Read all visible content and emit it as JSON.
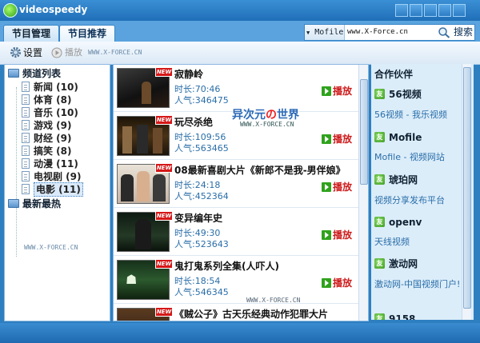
{
  "window": {
    "title": "videospeedy"
  },
  "tabs": [
    {
      "label": "节目管理",
      "active": false
    },
    {
      "label": "节目推荐",
      "active": true
    }
  ],
  "search": {
    "engine": "Mofile",
    "value": "www.X-Force.cn",
    "button": "搜索"
  },
  "toolbar": {
    "settings_label": "设置",
    "play_label": "播放",
    "watermark": "WWW.X-FORCE.CN"
  },
  "sidebar": {
    "root_label": "频道列表",
    "items": [
      {
        "label": "新闻 (10)"
      },
      {
        "label": "体育 (8)"
      },
      {
        "label": "音乐 (10)"
      },
      {
        "label": "游戏 (9)"
      },
      {
        "label": "财经 (9)"
      },
      {
        "label": "搞笑 (8)"
      },
      {
        "label": "动漫 (11)"
      },
      {
        "label": "电视剧 (9)"
      },
      {
        "label": "电影 (11)",
        "selected": true
      }
    ],
    "latest_label": "最新最热",
    "watermark": "WWW.X-FORCE.CN"
  },
  "videos": [
    {
      "title": "寂静岭",
      "duration": "时长:70:46",
      "popularity": "人气:346475",
      "badge": "NEW",
      "play": "播放"
    },
    {
      "title": "玩尽杀绝",
      "duration": "时长:109:56",
      "popularity": "人气:563465",
      "badge": "NEW",
      "play": "播放"
    },
    {
      "title": "08最新喜剧大片《新郎不是我-男伴娘》",
      "duration": "时长:24:18",
      "popularity": "人气:452364",
      "badge": "NEW",
      "play": "播放"
    },
    {
      "title": "变异编年史",
      "duration": "时长:49:30",
      "popularity": "人气:523643",
      "badge": "NEW",
      "play": "播放"
    },
    {
      "title": "鬼打鬼系列全集(人吓人)",
      "duration": "时长:18:54",
      "popularity": "人气:546345",
      "badge": "NEW",
      "play": "播放"
    },
    {
      "title": "《贼公子》古天乐经典动作犯罪大片",
      "duration": "",
      "popularity": "",
      "badge": "NEW",
      "play": ""
    }
  ],
  "watermark": {
    "logo_a": "异次元",
    "logo_b": "の",
    "logo_c": "世界",
    "sub": "WWW.X-FORCE.CN",
    "list_bottom": "WWW.X-FORCE.CN"
  },
  "partners": {
    "header": "合作伙伴",
    "items": [
      {
        "name": "56视频",
        "desc": "56视频 - 我乐视频"
      },
      {
        "name": "Mofile",
        "desc": "Mofile - 视频网站"
      },
      {
        "name": "琥珀网",
        "desc": "视频分享发布平台"
      },
      {
        "name": "openv",
        "desc": "天线视频"
      },
      {
        "name": "激动网",
        "desc": "激动网-中国视频门户!"
      },
      {
        "name": "9158",
        "desc": ""
      }
    ],
    "icon_glyph": "友"
  },
  "colors": {
    "title_bar": "#1f6fb8",
    "accent": "#2a6ea8",
    "play_red": "#cc1a1a",
    "badge_red": "#d41818"
  }
}
